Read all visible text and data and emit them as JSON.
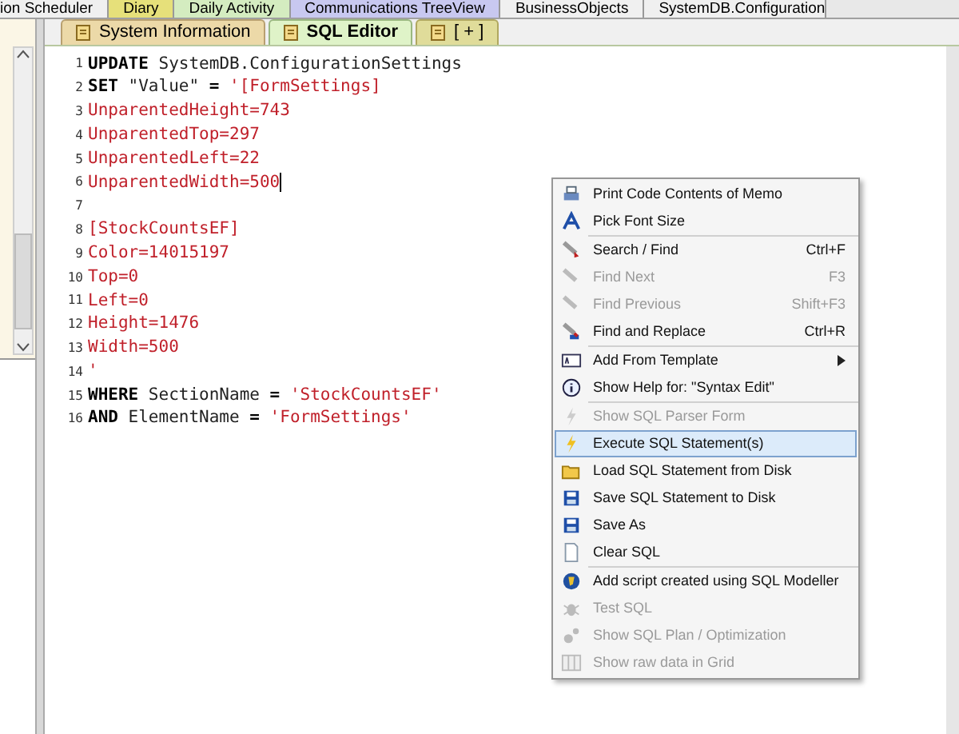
{
  "top_tabs": [
    {
      "label": "ion Scheduler",
      "color": "#f0f0f0",
      "selected": false
    },
    {
      "label": "Diary",
      "color": "#e6e07a",
      "selected": false
    },
    {
      "label": "Daily Activity",
      "color": "#d4ecc0",
      "selected": false
    },
    {
      "label": "Communications TreeView",
      "color": "#c8c8f0",
      "selected": false
    },
    {
      "label": "BusinessObjects",
      "color": "#f0f0f0",
      "selected": false
    },
    {
      "label": "SystemDB.Configuration",
      "color": "#f0f0f0",
      "selected": false
    }
  ],
  "editor_tabs": [
    {
      "label": "System Information",
      "selected": false
    },
    {
      "label": "SQL Editor",
      "selected": true
    },
    {
      "label": "[ + ]",
      "selected": false
    }
  ],
  "code_lines": [
    {
      "number": "1",
      "caret": false,
      "segments": [
        {
          "text": "UPDATE",
          "kind": "keyword"
        },
        {
          "text": " SystemDB.ConfigurationSettings",
          "kind": "plain"
        }
      ]
    },
    {
      "number": "2",
      "caret": false,
      "segments": [
        {
          "text": "SET",
          "kind": "keyword"
        },
        {
          "text": " \"Value\" ",
          "kind": "plain"
        },
        {
          "text": "=",
          "kind": "keyword"
        },
        {
          "text": " '[FormSettings]",
          "kind": "string"
        }
      ]
    },
    {
      "number": "3",
      "caret": false,
      "segments": [
        {
          "text": "UnparentedHeight=743",
          "kind": "string"
        }
      ]
    },
    {
      "number": "4",
      "caret": false,
      "segments": [
        {
          "text": "UnparentedTop=297",
          "kind": "string"
        }
      ]
    },
    {
      "number": "5",
      "caret": false,
      "segments": [
        {
          "text": "UnparentedLeft=22",
          "kind": "string"
        }
      ]
    },
    {
      "number": "6",
      "caret": true,
      "segments": [
        {
          "text": "UnparentedWidth=500",
          "kind": "string"
        }
      ]
    },
    {
      "number": "7",
      "caret": false
    },
    {
      "number": "8",
      "caret": false,
      "segments": [
        {
          "text": "[StockCountsEF]",
          "kind": "string"
        }
      ]
    },
    {
      "number": "9",
      "caret": false,
      "segments": [
        {
          "text": "Color=14015197",
          "kind": "string"
        }
      ]
    },
    {
      "number": "10",
      "caret": false,
      "segments": [
        {
          "text": "Top=0",
          "kind": "string"
        }
      ]
    },
    {
      "number": "11",
      "caret": false,
      "segments": [
        {
          "text": "Left=0",
          "kind": "string"
        }
      ]
    },
    {
      "number": "12",
      "caret": false,
      "segments": [
        {
          "text": "Height=1476",
          "kind": "string"
        }
      ]
    },
    {
      "number": "13",
      "caret": false,
      "segments": [
        {
          "text": "Width=500",
          "kind": "string"
        }
      ]
    },
    {
      "number": "14",
      "caret": false,
      "segments": [
        {
          "text": "'",
          "kind": "string"
        }
      ]
    },
    {
      "number": "15",
      "caret": false,
      "segments": [
        {
          "text": "WHERE",
          "kind": "keyword"
        },
        {
          "text": " SectionName ",
          "kind": "plain"
        },
        {
          "text": "=",
          "kind": "keyword"
        },
        {
          "text": " 'StockCountsEF'",
          "kind": "string"
        }
      ]
    },
    {
      "number": "16",
      "caret": false,
      "segments": [
        {
          "text": "AND",
          "kind": "keyword"
        },
        {
          "text": " ElementName ",
          "kind": "plain"
        },
        {
          "text": "=",
          "kind": "keyword"
        },
        {
          "text": " 'FormSettings'",
          "kind": "string"
        }
      ]
    }
  ],
  "context_menu": [
    {
      "kind": "item",
      "label": "Print Code Contents of Memo",
      "disabled": false,
      "selected": false,
      "submenu": false
    },
    {
      "kind": "item",
      "label": "Pick Font Size",
      "disabled": false,
      "selected": false,
      "submenu": false
    },
    {
      "kind": "separator"
    },
    {
      "kind": "item",
      "label": "Search / Find",
      "shortcut": "Ctrl+F",
      "disabled": false,
      "selected": false,
      "submenu": false
    },
    {
      "kind": "item",
      "label": "Find Next",
      "shortcut": "F3",
      "disabled": true,
      "selected": false,
      "submenu": false
    },
    {
      "kind": "item",
      "label": "Find Previous",
      "shortcut": "Shift+F3",
      "disabled": true,
      "selected": false,
      "submenu": false
    },
    {
      "kind": "item",
      "label": "Find and Replace",
      "shortcut": "Ctrl+R",
      "disabled": false,
      "selected": false,
      "submenu": false
    },
    {
      "kind": "separator"
    },
    {
      "kind": "item",
      "label": "Add From Template",
      "disabled": false,
      "selected": false,
      "submenu": true
    },
    {
      "kind": "item",
      "label": "Show Help for: \"Syntax Edit\"",
      "disabled": false,
      "selected": false,
      "submenu": false
    },
    {
      "kind": "separator"
    },
    {
      "kind": "item",
      "label": "Show SQL Parser Form",
      "disabled": true,
      "selected": false,
      "submenu": false
    },
    {
      "kind": "item",
      "label": "Execute SQL Statement(s)",
      "disabled": false,
      "selected": true,
      "submenu": false
    },
    {
      "kind": "item",
      "label": "Load SQL Statement from Disk",
      "disabled": false,
      "selected": false,
      "submenu": false
    },
    {
      "kind": "item",
      "label": "Save SQL Statement to Disk",
      "disabled": false,
      "selected": false,
      "submenu": false
    },
    {
      "kind": "item",
      "label": "Save As",
      "disabled": false,
      "selected": false,
      "submenu": false
    },
    {
      "kind": "item",
      "label": "Clear SQL",
      "disabled": false,
      "selected": false,
      "submenu": false
    },
    {
      "kind": "separator"
    },
    {
      "kind": "item",
      "label": "Add script created using SQL Modeller",
      "disabled": false,
      "selected": false,
      "submenu": false
    },
    {
      "kind": "item",
      "label": "Test SQL",
      "disabled": true,
      "selected": false,
      "submenu": false
    },
    {
      "kind": "item",
      "label": "Show SQL Plan / Optimization",
      "disabled": true,
      "selected": false,
      "submenu": false
    },
    {
      "kind": "item",
      "label": "Show raw data in Grid",
      "disabled": true,
      "selected": false,
      "submenu": false
    }
  ]
}
